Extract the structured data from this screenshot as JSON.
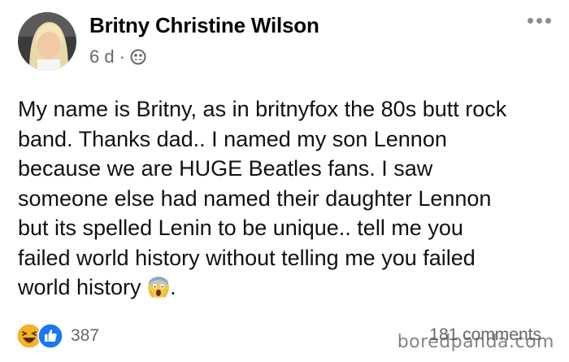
{
  "post": {
    "author": "Britny Christine Wilson",
    "timestamp": "6 d",
    "separator": "·",
    "audience_icon": "friends-icon",
    "text_lines": [
      "My name is Britny, as in britnyfox the 80s butt rock",
      "band. Thanks dad.. I named my son Lennon",
      "because we are HUGE Beatles fans. I saw",
      "someone else had named their daughter Lennon",
      "but its spelled Lenin to be unique.. tell me you",
      "failed world history without telling me you failed",
      "world history"
    ],
    "text_tail": ".",
    "inline_emoji": "face-screaming-in-fear-icon"
  },
  "footer": {
    "reaction_icons": [
      "haha-reaction-icon",
      "like-reaction-icon"
    ],
    "reaction_count": "387",
    "comments_label": "181 comments"
  },
  "watermark": "boredpanda.com",
  "colors": {
    "text": "#111111",
    "secondary": "#65676b",
    "like_blue": "#1877f2",
    "haha_yellow": "#f7b125"
  }
}
